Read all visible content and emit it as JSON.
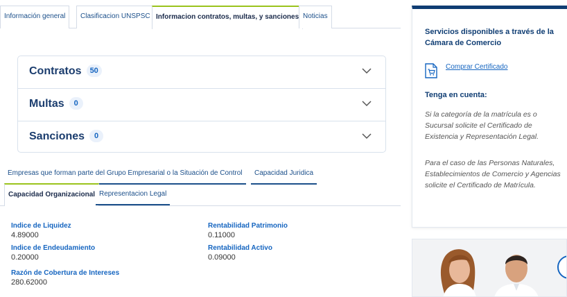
{
  "tabs": [
    {
      "label": "Información general",
      "active": false
    },
    {
      "label": "Clasificacion UNSPSC",
      "active": false
    },
    {
      "label": "Informacion contratos, multas, y sanciones",
      "active": true
    },
    {
      "label": "Noticias",
      "active": false
    }
  ],
  "accordion": {
    "contratos": {
      "label": "Contratos",
      "count": "50"
    },
    "multas": {
      "label": "Multas",
      "count": "0"
    },
    "sanciones": {
      "label": "Sanciones",
      "count": "0"
    }
  },
  "subtabs": {
    "grupo": "Empresas que forman parte del Grupo Empresarial o la Situación de Control",
    "juridica": "Capacidad Juridica",
    "organizacional": "Capacidad Organizacional",
    "representacion": "Representacion Legal"
  },
  "indicators": {
    "liquidez": {
      "label": "Indice de Liquidez",
      "value": "4.89000"
    },
    "endeudamiento": {
      "label": "Indice de Endeudamiento",
      "value": "0.20000"
    },
    "cobertura": {
      "label": "Razón de Cobertura de Intereses",
      "value": "280.62000"
    },
    "patrimonio": {
      "label": "Rentabilidad Patrimonio",
      "value": "0.11000"
    },
    "activo": {
      "label": "Rentabilidad Activo",
      "value": "0.09000"
    }
  },
  "sidebar": {
    "title": "Servicios disponibles a través de la Cámara de Comercio",
    "cert_link": "Comprar Certificado",
    "note_title": "Tenga en cuenta:",
    "note_1": "Si la categoría de la matrícula es o Sucursal solicite el Certificado de Existencia y Representación Legal.",
    "note_2": "Para el caso de las Personas Naturales, Establecimientos de Comercio y Agencias solicite el Certificado de Matrícula."
  },
  "colors": {
    "accent_green": "#9ac31c",
    "navy": "#0f3d73",
    "link_blue": "#1565c0"
  }
}
